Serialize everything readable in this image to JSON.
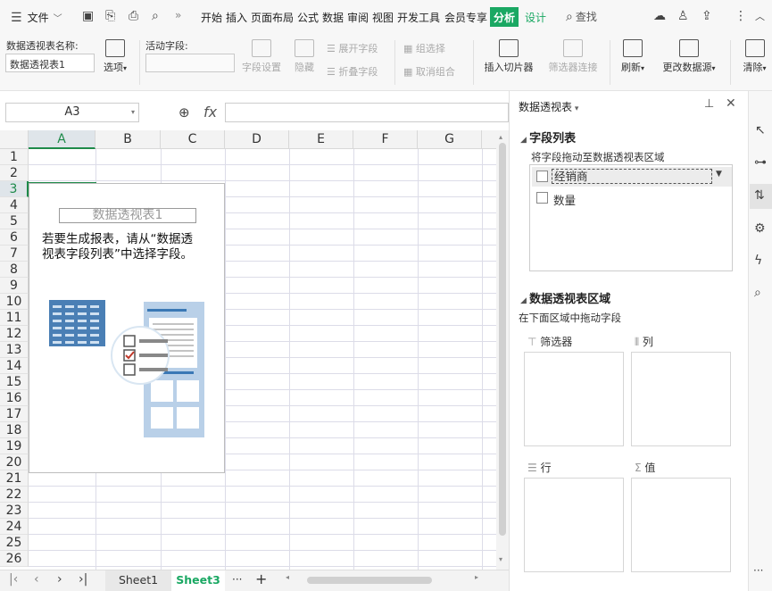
{
  "menubar": {
    "file": "文件",
    "tabs": [
      "开始",
      "插入",
      "页面布局",
      "公式",
      "数据",
      "审阅",
      "视图",
      "开发工具",
      "会员专享",
      "分析",
      "设计"
    ],
    "search": "查找"
  },
  "ribbon": {
    "pivot_name_label": "数据透视表名称:",
    "pivot_name_value": "数据透视表1",
    "options": "选项",
    "active_field_label": "活动字段:",
    "field_settings": "字段设置",
    "hide": "隐藏",
    "expand_field": "展开字段",
    "collapse_field": "折叠字段",
    "group_selection": "组选择",
    "ungroup": "取消组合",
    "insert_slicer": "插入切片器",
    "filter_connection": "筛选器连接",
    "refresh": "刷新",
    "change_source": "更改数据源",
    "clear": "清除"
  },
  "formula": {
    "name_box": "A3",
    "fx": "fx"
  },
  "grid": {
    "columns": [
      "A",
      "B",
      "C",
      "D",
      "E",
      "F",
      "G"
    ],
    "rows": [
      "1",
      "2",
      "3",
      "4",
      "5",
      "6",
      "7",
      "8",
      "9",
      "10",
      "11",
      "12",
      "13",
      "14",
      "15",
      "16",
      "17",
      "18",
      "19",
      "20",
      "21",
      "22",
      "23",
      "24",
      "25",
      "26"
    ]
  },
  "pivot_placeholder": {
    "title": "数据透视表1",
    "line1": "若要生成报表，请从“数据透",
    "line2": "视表字段列表”中选择字段。"
  },
  "sheets": {
    "sheet1": "Sheet1",
    "sheet3": "Sheet3",
    "more": "···",
    "add": "+"
  },
  "pane": {
    "title": "数据透视表",
    "field_list": "字段列表",
    "drag_hint": "将字段拖动至数据透视表区域",
    "fields": [
      "经销商",
      "数量"
    ],
    "areas_title": "数据透视表区域",
    "areas_hint": "在下面区域中拖动字段",
    "filter": "筛选器",
    "columns": "列",
    "rows": "行",
    "values": "值"
  },
  "colors": {
    "accent": "#1aa863",
    "analysis_tab_bg": "#1aa863",
    "design_tab": "#1aa863",
    "selection": "#1e8a4a"
  }
}
